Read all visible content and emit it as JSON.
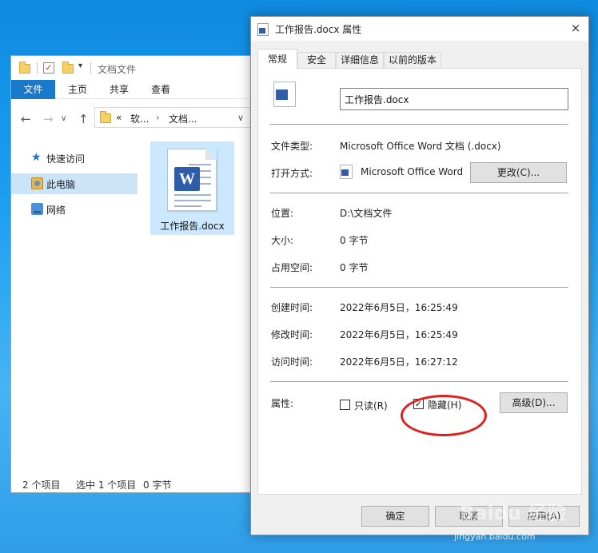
{
  "explorer": {
    "title": "文档文件",
    "ribbon_tabs": [
      "文件",
      "主页",
      "共享",
      "查看"
    ],
    "address": {
      "overflow": "«",
      "crumb1": "软...",
      "sep": "›",
      "crumb2": "文档..."
    },
    "nav": {
      "quick_access": "快速访问",
      "this_pc": "此电脑",
      "network": "网络"
    },
    "file_name": "工作报告.docx",
    "status": {
      "count": "2 个项目",
      "selected": "选中 1 个项目",
      "size": "0 字节"
    }
  },
  "dialog": {
    "title": "工作报告.docx 属性",
    "close": "×",
    "tabs": [
      "常规",
      "安全",
      "详细信息",
      "以前的版本"
    ],
    "name_value": "工作报告.docx",
    "file_type_label": "文件类型:",
    "file_type_value": "Microsoft Office Word 文档 (.docx)",
    "open_with_label": "打开方式:",
    "open_with_value": "Microsoft Office Word",
    "change_button": "更改(C)...",
    "location_label": "位置:",
    "location_value": "D:\\文档文件",
    "size_label": "大小:",
    "size_value": "0 字节",
    "disk_size_label": "占用空间:",
    "disk_size_value": "0 字节",
    "created_label": "创建时间:",
    "created_value": "2022年6月5日，16:25:49",
    "modified_label": "修改时间:",
    "modified_value": "2022年6月5日，16:25:49",
    "accessed_label": "访问时间:",
    "accessed_value": "2022年6月5日，16:27:12",
    "attributes_label": "属性:",
    "readonly_label": "只读(R)",
    "readonly_checked": false,
    "hidden_label": "隐藏(H)",
    "hidden_checked": true,
    "advanced_button": "高级(D)...",
    "ok_button": "确定",
    "cancel_button": "取消",
    "apply_button": "应用(A)"
  },
  "watermark": {
    "brand": "Baidu 经验",
    "url": "jingyan.baidu.com"
  },
  "colors": {
    "accent": "#1979ca",
    "selection": "#cce4f7",
    "highlight_circle": "#e02020"
  }
}
